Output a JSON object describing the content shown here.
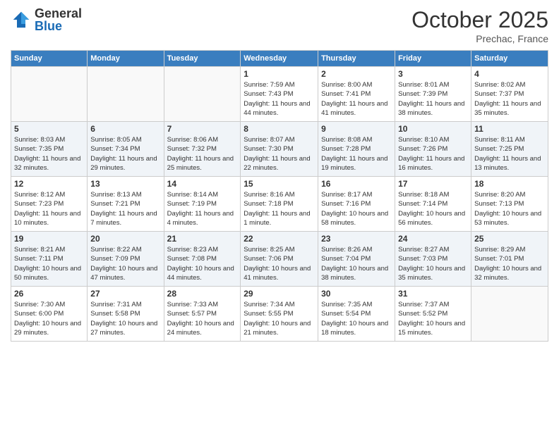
{
  "header": {
    "logo_general": "General",
    "logo_blue": "Blue",
    "month": "October 2025",
    "location": "Prechac, France"
  },
  "days_of_week": [
    "Sunday",
    "Monday",
    "Tuesday",
    "Wednesday",
    "Thursday",
    "Friday",
    "Saturday"
  ],
  "weeks": [
    [
      {
        "day": "",
        "info": ""
      },
      {
        "day": "",
        "info": ""
      },
      {
        "day": "",
        "info": ""
      },
      {
        "day": "1",
        "sunrise": "Sunrise: 7:59 AM",
        "sunset": "Sunset: 7:43 PM",
        "daylight": "Daylight: 11 hours and 44 minutes."
      },
      {
        "day": "2",
        "sunrise": "Sunrise: 8:00 AM",
        "sunset": "Sunset: 7:41 PM",
        "daylight": "Daylight: 11 hours and 41 minutes."
      },
      {
        "day": "3",
        "sunrise": "Sunrise: 8:01 AM",
        "sunset": "Sunset: 7:39 PM",
        "daylight": "Daylight: 11 hours and 38 minutes."
      },
      {
        "day": "4",
        "sunrise": "Sunrise: 8:02 AM",
        "sunset": "Sunset: 7:37 PM",
        "daylight": "Daylight: 11 hours and 35 minutes."
      }
    ],
    [
      {
        "day": "5",
        "sunrise": "Sunrise: 8:03 AM",
        "sunset": "Sunset: 7:35 PM",
        "daylight": "Daylight: 11 hours and 32 minutes."
      },
      {
        "day": "6",
        "sunrise": "Sunrise: 8:05 AM",
        "sunset": "Sunset: 7:34 PM",
        "daylight": "Daylight: 11 hours and 29 minutes."
      },
      {
        "day": "7",
        "sunrise": "Sunrise: 8:06 AM",
        "sunset": "Sunset: 7:32 PM",
        "daylight": "Daylight: 11 hours and 25 minutes."
      },
      {
        "day": "8",
        "sunrise": "Sunrise: 8:07 AM",
        "sunset": "Sunset: 7:30 PM",
        "daylight": "Daylight: 11 hours and 22 minutes."
      },
      {
        "day": "9",
        "sunrise": "Sunrise: 8:08 AM",
        "sunset": "Sunset: 7:28 PM",
        "daylight": "Daylight: 11 hours and 19 minutes."
      },
      {
        "day": "10",
        "sunrise": "Sunrise: 8:10 AM",
        "sunset": "Sunset: 7:26 PM",
        "daylight": "Daylight: 11 hours and 16 minutes."
      },
      {
        "day": "11",
        "sunrise": "Sunrise: 8:11 AM",
        "sunset": "Sunset: 7:25 PM",
        "daylight": "Daylight: 11 hours and 13 minutes."
      }
    ],
    [
      {
        "day": "12",
        "sunrise": "Sunrise: 8:12 AM",
        "sunset": "Sunset: 7:23 PM",
        "daylight": "Daylight: 11 hours and 10 minutes."
      },
      {
        "day": "13",
        "sunrise": "Sunrise: 8:13 AM",
        "sunset": "Sunset: 7:21 PM",
        "daylight": "Daylight: 11 hours and 7 minutes."
      },
      {
        "day": "14",
        "sunrise": "Sunrise: 8:14 AM",
        "sunset": "Sunset: 7:19 PM",
        "daylight": "Daylight: 11 hours and 4 minutes."
      },
      {
        "day": "15",
        "sunrise": "Sunrise: 8:16 AM",
        "sunset": "Sunset: 7:18 PM",
        "daylight": "Daylight: 11 hours and 1 minute."
      },
      {
        "day": "16",
        "sunrise": "Sunrise: 8:17 AM",
        "sunset": "Sunset: 7:16 PM",
        "daylight": "Daylight: 10 hours and 58 minutes."
      },
      {
        "day": "17",
        "sunrise": "Sunrise: 8:18 AM",
        "sunset": "Sunset: 7:14 PM",
        "daylight": "Daylight: 10 hours and 56 minutes."
      },
      {
        "day": "18",
        "sunrise": "Sunrise: 8:20 AM",
        "sunset": "Sunset: 7:13 PM",
        "daylight": "Daylight: 10 hours and 53 minutes."
      }
    ],
    [
      {
        "day": "19",
        "sunrise": "Sunrise: 8:21 AM",
        "sunset": "Sunset: 7:11 PM",
        "daylight": "Daylight: 10 hours and 50 minutes."
      },
      {
        "day": "20",
        "sunrise": "Sunrise: 8:22 AM",
        "sunset": "Sunset: 7:09 PM",
        "daylight": "Daylight: 10 hours and 47 minutes."
      },
      {
        "day": "21",
        "sunrise": "Sunrise: 8:23 AM",
        "sunset": "Sunset: 7:08 PM",
        "daylight": "Daylight: 10 hours and 44 minutes."
      },
      {
        "day": "22",
        "sunrise": "Sunrise: 8:25 AM",
        "sunset": "Sunset: 7:06 PM",
        "daylight": "Daylight: 10 hours and 41 minutes."
      },
      {
        "day": "23",
        "sunrise": "Sunrise: 8:26 AM",
        "sunset": "Sunset: 7:04 PM",
        "daylight": "Daylight: 10 hours and 38 minutes."
      },
      {
        "day": "24",
        "sunrise": "Sunrise: 8:27 AM",
        "sunset": "Sunset: 7:03 PM",
        "daylight": "Daylight: 10 hours and 35 minutes."
      },
      {
        "day": "25",
        "sunrise": "Sunrise: 8:29 AM",
        "sunset": "Sunset: 7:01 PM",
        "daylight": "Daylight: 10 hours and 32 minutes."
      }
    ],
    [
      {
        "day": "26",
        "sunrise": "Sunrise: 7:30 AM",
        "sunset": "Sunset: 6:00 PM",
        "daylight": "Daylight: 10 hours and 29 minutes."
      },
      {
        "day": "27",
        "sunrise": "Sunrise: 7:31 AM",
        "sunset": "Sunset: 5:58 PM",
        "daylight": "Daylight: 10 hours and 27 minutes."
      },
      {
        "day": "28",
        "sunrise": "Sunrise: 7:33 AM",
        "sunset": "Sunset: 5:57 PM",
        "daylight": "Daylight: 10 hours and 24 minutes."
      },
      {
        "day": "29",
        "sunrise": "Sunrise: 7:34 AM",
        "sunset": "Sunset: 5:55 PM",
        "daylight": "Daylight: 10 hours and 21 minutes."
      },
      {
        "day": "30",
        "sunrise": "Sunrise: 7:35 AM",
        "sunset": "Sunset: 5:54 PM",
        "daylight": "Daylight: 10 hours and 18 minutes."
      },
      {
        "day": "31",
        "sunrise": "Sunrise: 7:37 AM",
        "sunset": "Sunset: 5:52 PM",
        "daylight": "Daylight: 10 hours and 15 minutes."
      },
      {
        "day": "",
        "info": ""
      }
    ]
  ]
}
